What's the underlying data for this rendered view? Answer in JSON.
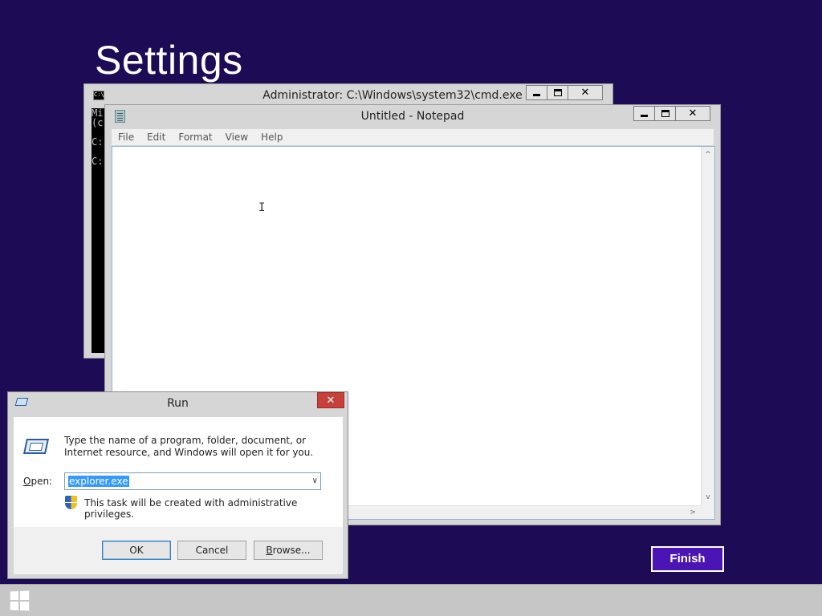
{
  "settings": {
    "title": "Settings"
  },
  "cmd": {
    "title": "Administrator: C:\\Windows\\system32\\cmd.exe",
    "lines": [
      "Mi",
      "(c",
      "",
      "C:",
      "",
      "C:"
    ],
    "icon": "cmd-icon"
  },
  "notepad": {
    "title": "Untitled - Notepad",
    "menu": [
      "File",
      "Edit",
      "Format",
      "View",
      "Help"
    ],
    "caret": "I"
  },
  "run": {
    "title": "Run",
    "description": "Type the name of a program, folder, document, or Internet resource, and Windows will open it for you.",
    "open_label_u": "O",
    "open_label_rest": "pen:",
    "input_value": "explorer.exe",
    "admin_note": "This task will be created with administrative privileges.",
    "ok": "OK",
    "cancel": "Cancel",
    "browse_u": "B",
    "browse_rest": "rowse..."
  },
  "finish": {
    "label": "Finish"
  },
  "glyphs": {
    "close": "✕",
    "dropdown": "∨",
    "up": "^",
    "down": "v",
    "right": ">"
  },
  "colors": {
    "background": "#1e0b55",
    "finish": "#4b14b4",
    "close_red": "#c7413b",
    "selection": "#3399ff"
  }
}
